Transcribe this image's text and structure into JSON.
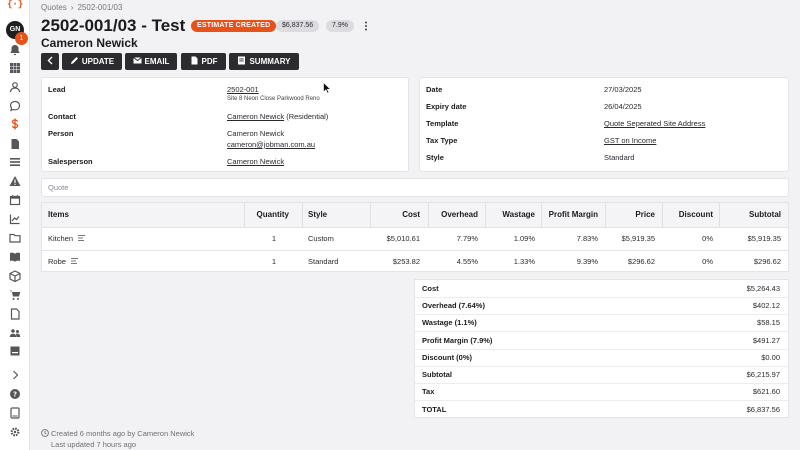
{
  "sidebar": {
    "logo": "{·}",
    "avatar_initials": "GN",
    "notification_count": "1",
    "icons": [
      "bell-icon",
      "grid-icon",
      "user-icon",
      "chat-icon",
      "dollar-icon",
      "document-icon",
      "list-icon",
      "warning-icon",
      "calendar-icon",
      "chart-icon",
      "folder-icon",
      "book-icon",
      "box-icon",
      "cart-icon",
      "file-icon",
      "team-icon",
      "archive-icon",
      "chevron-right-icon",
      "help-icon",
      "tablet-icon",
      "gear-icon"
    ],
    "active": "dollar-icon",
    "accent": "#e8521a"
  },
  "breadcrumb": {
    "root": "Quotes",
    "separator": "›",
    "current": "2502-001/03"
  },
  "header": {
    "title": "2502-001/03 - Test",
    "status": "ESTIMATE CREATED",
    "amount": "$6,837.56",
    "percent": "7.9%",
    "customer": "Cameron Newick"
  },
  "toolbar": {
    "back_icon": "chevron-left-icon",
    "update_label": "UPDATE",
    "email_label": "EMAIL",
    "pdf_label": "PDF",
    "summary_label": "SUMMARY"
  },
  "details_left": {
    "lead_label": "Lead",
    "lead_value": "2502-001",
    "lead_address": "Site 8 Neon Close Parkwood Reno",
    "contact_label": "Contact",
    "contact_value": "Cameron Newick",
    "contact_type": "(Residential)",
    "person_label": "Person",
    "person_name": "Cameron Newick",
    "person_email": "cameron@jobman.com.au",
    "salesperson_label": "Salesperson",
    "salesperson_value": "Cameron Newick"
  },
  "details_right": {
    "date_label": "Date",
    "date_value": "27/03/2025",
    "expiry_label": "Expiry date",
    "expiry_value": "26/04/2025",
    "template_label": "Template",
    "template_value": "Quote Seperated Site Address",
    "tax_label": "Tax Type",
    "tax_value": "GST on Income",
    "style_label": "Style",
    "style_value": "Standard"
  },
  "quote_placeholder": "Quote",
  "items_table": {
    "headers": [
      "Items",
      "Quantity",
      "Style",
      "Cost",
      "Overhead",
      "Wastage",
      "Profit Margin",
      "Price",
      "Discount",
      "Subtotal"
    ],
    "rows": [
      [
        "Kitchen",
        "1",
        "Custom",
        "$5,010.61",
        "7.79%",
        "1.09%",
        "7.83%",
        "$5,919.35",
        "0%",
        "$5,919.35"
      ],
      [
        "Robe",
        "1",
        "Standard",
        "$253.82",
        "4.55%",
        "1.33%",
        "9.39%",
        "$296.62",
        "0%",
        "$296.62"
      ]
    ]
  },
  "summary": {
    "rows": [
      [
        "Cost",
        "$5,264.43"
      ],
      [
        "Overhead (7.64%)",
        "$402.12"
      ],
      [
        "Wastage (1.1%)",
        "$58.15"
      ],
      [
        "Profit Margin (7.9%)",
        "$491.27"
      ],
      [
        "Discount (0%)",
        "$0.00"
      ],
      [
        "Subtotal",
        "$6,215.97"
      ],
      [
        "Tax",
        "$621.60"
      ],
      [
        "TOTAL",
        "$6,837.56"
      ]
    ]
  },
  "footer": {
    "created": "Created 6 months ago by Cameron Newick",
    "updated": "Last updated 7 hours ago"
  }
}
